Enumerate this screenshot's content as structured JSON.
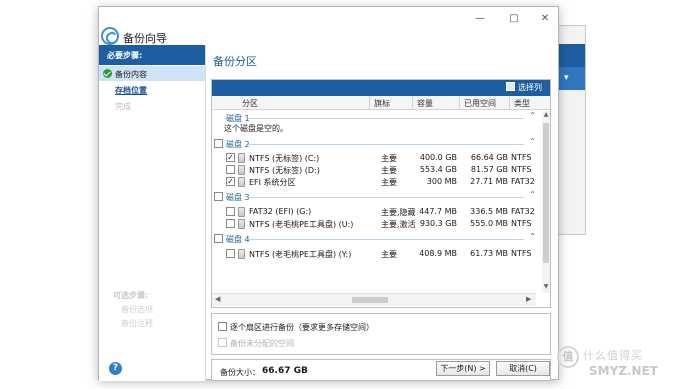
{
  "window": {
    "title": "备份向导",
    "minimize": "—",
    "maximize": "□",
    "close": "✕"
  },
  "background_window": {
    "label": "▾"
  },
  "sidebar": {
    "header": "必要步骤:",
    "items": [
      {
        "label": "备份内容",
        "state": "active-completed"
      },
      {
        "label": "存档位置",
        "state": "link"
      },
      {
        "label": "完成",
        "state": "disabled"
      }
    ],
    "optional_header": "可选步骤:",
    "optional_items": [
      "备份选项",
      "备份注释"
    ]
  },
  "main": {
    "title": "备份分区",
    "toolbar": {
      "columns_button": "选择列"
    },
    "columns": [
      "分区",
      "旗标",
      "容量",
      "已用空间",
      "类型"
    ],
    "disks": [
      {
        "label": "磁盘 1",
        "note": "这个磁盘是空的。",
        "partitions": []
      },
      {
        "label": "磁盘 2",
        "partitions": [
          {
            "name": "NTFS (无标签) (C:)",
            "flag": "主要",
            "capacity": "400.0 GB",
            "used": "66.64 GB",
            "type": "NTFS",
            "checked": true
          },
          {
            "name": "NTFS (无标签) (D:)",
            "flag": "主要",
            "capacity": "553.4 GB",
            "used": "81.57 GB",
            "type": "NTFS",
            "checked": false
          },
          {
            "name": "EFI 系统分区",
            "flag": "主要",
            "capacity": "300 MB",
            "used": "27.71 MB",
            "type": "FAT32",
            "checked": true
          }
        ]
      },
      {
        "label": "磁盘 3",
        "partitions": [
          {
            "name": "FAT32 (EFI) (G:)",
            "flag": "主要,隐藏",
            "capacity": "447.7 MB",
            "used": "336.5 MB",
            "type": "FAT32",
            "checked": false
          },
          {
            "name": "NTFS (老毛桃PE工具盘) (U:)",
            "flag": "主要,激活",
            "capacity": "930.3 GB",
            "used": "555.0 MB",
            "type": "NTFS",
            "checked": false
          }
        ]
      },
      {
        "label": "磁盘 4",
        "partitions": [
          {
            "name": "NTFS (老毛桃PE工具盘) (Y:)",
            "flag": "主要",
            "capacity": "408.9 MB",
            "used": "61.73 MB",
            "type": "NTFS",
            "checked": false
          }
        ]
      }
    ],
    "options": {
      "sector_by_sector": "逐个扇区进行备份（要求更多存储空间）",
      "unallocated": "备份未分配的空间"
    },
    "backup_size_label": "备份大小：",
    "backup_size_value": "66.67 GB"
  },
  "footer": {
    "next": "下一步(N) >",
    "cancel": "取消(C)"
  },
  "watermark": {
    "cn": "什么值得买",
    "en": "SMYZ.NET",
    "logo": "值"
  },
  "colors": {
    "accent": "#1c5ea0",
    "selected": "#cfe3f6",
    "ok_green": "#2d9a3c"
  }
}
